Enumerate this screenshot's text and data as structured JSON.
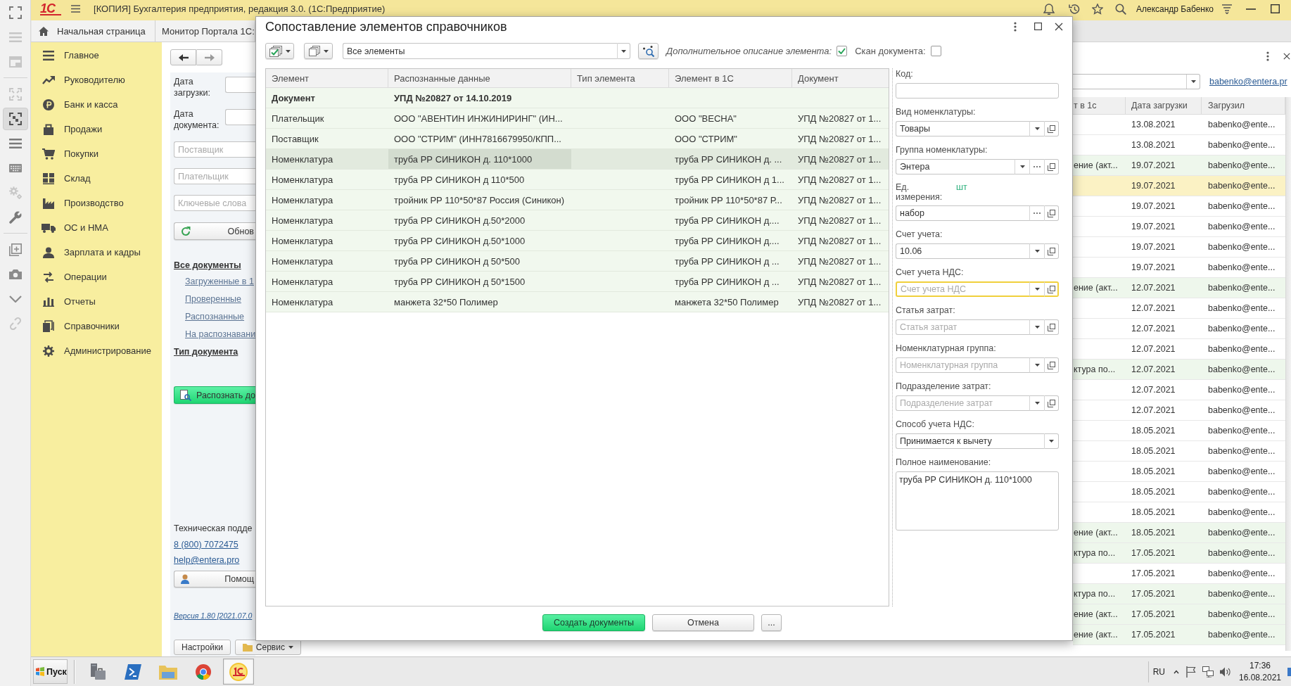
{
  "icon_strip": [
    {
      "selected": false
    },
    {
      "selected": false
    },
    {
      "selected": false
    },
    {
      "selected": false
    },
    {
      "selected": true
    },
    {
      "selected": false
    },
    {
      "selected": false
    },
    {
      "selected": false
    },
    {
      "selected": false
    },
    {
      "selected": false
    },
    {
      "selected": false
    },
    {
      "selected": false
    },
    {
      "selected": false
    }
  ],
  "app_bar": {
    "logo": "1С",
    "title": "[КОПИЯ] Бухгалтерия предприятия, редакция 3.0. (1С:Предприятие)",
    "user": "Александр Бабенко"
  },
  "open_tabs": [
    "Начальная страница",
    "Монитор Портала 1С:"
  ],
  "sections": [
    "Главное",
    "Руководителю",
    "Банк и касса",
    "Продажи",
    "Покупки",
    "Склад",
    "Производство",
    "ОС и НМА",
    "Зарплата и кадры",
    "Операции",
    "Отчеты",
    "Справочники",
    "Администрирование"
  ],
  "monitor_form": {
    "date_fields": [
      "Дата загрузки:",
      "Дата документа:"
    ],
    "filters": [
      {
        "placeholder": "Поставщик"
      },
      {
        "placeholder": "Плательщик"
      },
      {
        "placeholder": "Ключевые слова"
      }
    ],
    "refresh_button": "Обнов",
    "document_tree": [
      {
        "label": "Все документы",
        "children": [
          "Загруженные в 1",
          "Проверенные",
          "Распознанные",
          "На распознавани"
        ]
      },
      {
        "label": "Тип документа"
      }
    ],
    "recognize_button": "Распознать до",
    "support": {
      "label": "Техническая подде",
      "phone": "8 (800) 7072475",
      "email": "help@entera.pro",
      "help_button": "Помощ"
    },
    "version_link": "Версия 1.80 [2021.07.0",
    "footer_buttons": [
      "Настройки",
      "Сервис"
    ]
  },
  "document_list": {
    "user_link": "babenko@entera.pr",
    "columns": [
      "т в 1с",
      "Дата загрузки",
      "Загрузил"
    ],
    "rows": [
      {
        "upload_date": "13.08.2021",
        "uploaded_by": "babenko@ente...",
        "selected": false,
        "highlighted": false
      },
      {
        "upload_date": "13.08.2021",
        "uploaded_by": "babenko@ente...",
        "selected": false,
        "highlighted": false
      },
      {
        "column_1": "ение (акт...",
        "upload_date": "19.07.2021",
        "uploaded_by": "babenko@ente...",
        "selected": false,
        "highlighted": true
      },
      {
        "upload_date": "19.07.2021",
        "uploaded_by": "babenko@ente...",
        "selected": true,
        "highlighted": false
      },
      {
        "upload_date": "19.07.2021",
        "uploaded_by": "babenko@ente...",
        "selected": false,
        "highlighted": false
      },
      {
        "upload_date": "19.07.2021",
        "uploaded_by": "babenko@ente...",
        "selected": false,
        "highlighted": false
      },
      {
        "upload_date": "19.07.2021",
        "uploaded_by": "babenko@ente...",
        "selected": false,
        "highlighted": false
      },
      {
        "upload_date": "19.07.2021",
        "uploaded_by": "babenko@ente...",
        "selected": false,
        "highlighted": false
      },
      {
        "column_1": "ение (акт...",
        "upload_date": "12.07.2021",
        "uploaded_by": "babenko@ente...",
        "selected": false,
        "highlighted": true
      },
      {
        "upload_date": "12.07.2021",
        "uploaded_by": "babenko@ente...",
        "selected": false,
        "highlighted": false
      },
      {
        "upload_date": "12.07.2021",
        "uploaded_by": "babenko@ente...",
        "selected": false,
        "highlighted": false
      },
      {
        "upload_date": "12.07.2021",
        "uploaded_by": "babenko@ente...",
        "selected": false,
        "highlighted": false
      },
      {
        "column_1": "ктура по...",
        "upload_date": "12.07.2021",
        "uploaded_by": "babenko@ente...",
        "selected": false,
        "highlighted": true
      },
      {
        "upload_date": "12.07.2021",
        "uploaded_by": "babenko@ente...",
        "selected": false,
        "highlighted": false
      },
      {
        "upload_date": "12.07.2021",
        "uploaded_by": "babenko@ente...",
        "selected": false,
        "highlighted": false
      },
      {
        "upload_date": "18.05.2021",
        "uploaded_by": "babenko@ente...",
        "selected": false,
        "highlighted": false
      },
      {
        "upload_date": "18.05.2021",
        "uploaded_by": "babenko@ente...",
        "selected": false,
        "highlighted": false
      },
      {
        "upload_date": "18.05.2021",
        "uploaded_by": "babenko@ente...",
        "selected": false,
        "highlighted": false
      },
      {
        "upload_date": "18.05.2021",
        "uploaded_by": "babenko@ente...",
        "selected": false,
        "highlighted": false
      },
      {
        "upload_date": "18.05.2021",
        "uploaded_by": "babenko@ente...",
        "selected": false,
        "highlighted": false
      },
      {
        "column_1": "ение (акт...",
        "upload_date": "18.05.2021",
        "uploaded_by": "babenko@ente...",
        "selected": false,
        "highlighted": true
      },
      {
        "column_1": "ктура по...",
        "upload_date": "17.05.2021",
        "uploaded_by": "babenko@ente...",
        "selected": false,
        "highlighted": true
      },
      {
        "upload_date": "17.05.2021",
        "uploaded_by": "babenko@ente...",
        "selected": false,
        "highlighted": false
      },
      {
        "column_1": "ктура по...",
        "upload_date": "17.05.2021",
        "uploaded_by": "babenko@ente...",
        "selected": false,
        "highlighted": true
      },
      {
        "column_1": "ение (акт...",
        "upload_date": "17.05.2021",
        "uploaded_by": "babenko@ente...",
        "selected": false,
        "highlighted": true
      },
      {
        "column_1": "ение (акт...",
        "upload_date": "17.05.2021",
        "uploaded_by": "babenko@ente...",
        "selected": false,
        "highlighted": true
      }
    ]
  },
  "dialog": {
    "title": "Сопоставление элементов справочников",
    "filter": "Все элементы",
    "options": [
      {
        "label": "Дополнительное описание элемента:",
        "checked": true
      },
      {
        "label": "Скан документа:",
        "checked": false
      }
    ],
    "table": {
      "columns": [
        "Элемент",
        "Распознанные данные",
        "Тип элемента",
        "Элемент в 1С",
        "Документ"
      ],
      "rows": [
        {
          "kind": "document",
          "selected": false,
          "element": "Документ",
          "recognized": "УПД №20827 от 14.10.2019"
        },
        {
          "kind": "item",
          "selected": false,
          "element": "Плательщик",
          "recognized": "ООО \"АВЕНТИН ИНЖИНИРИНГ\" (ИН...",
          "element_1c": "ООО \"ВЕСНА\"",
          "document": "УПД №20827 от 1..."
        },
        {
          "kind": "item",
          "selected": false,
          "element": "Поставщик",
          "recognized": "ООО \"СТРИМ\" (ИНН7816679950/КПП...",
          "element_1c": "ООО \"СТРИМ\"",
          "document": "УПД №20827 от 1..."
        },
        {
          "kind": "item",
          "selected": true,
          "element": "Номенклатура",
          "recognized": "труба РР СИНИКОН д. 110*1000",
          "element_1c": "труба РР СИНИКОН д. ...",
          "document": "УПД №20827 от 1..."
        },
        {
          "kind": "item",
          "selected": false,
          "element": "Номенклатура",
          "recognized": "труба РР СИНИКОН д 110*500",
          "element_1c": "труба РР СИНИКОН д 1...",
          "document": "УПД №20827 от 1..."
        },
        {
          "kind": "item",
          "selected": false,
          "element": "Номенклатура",
          "recognized": "тройник РР 110*50*87 Россия (Синикон)",
          "element_1c": "тройник РР 110*50*87 Р...",
          "document": "УПД №20827 от 1..."
        },
        {
          "kind": "item",
          "selected": false,
          "element": "Номенклатура",
          "recognized": "труба РР СИНИКОН д.50*2000",
          "element_1c": "труба РР СИНИКОН д....",
          "document": "УПД №20827 от 1..."
        },
        {
          "kind": "item",
          "selected": false,
          "element": "Номенклатура",
          "recognized": "труба РР СИНИКОН д.50*1000",
          "element_1c": "труба РР СИНИКОН д....",
          "document": "УПД №20827 от 1..."
        },
        {
          "kind": "item",
          "selected": false,
          "element": "Номенклатура",
          "recognized": "труба РР СИНИКОН д 50*500",
          "element_1c": "труба РР СИНИКОН д ...",
          "document": "УПД №20827 от 1..."
        },
        {
          "kind": "item",
          "selected": false,
          "element": "Номенклатура",
          "recognized": "труба РР СИНИКОН д 50*1500",
          "element_1c": "труба РР СИНИКОН д ...",
          "document": "УПД №20827 от 1..."
        },
        {
          "kind": "item",
          "selected": false,
          "element": "Номенклатура",
          "recognized": "манжета 32*50 Полимер",
          "element_1c": "манжета 32*50 Полимер",
          "document": "УПД №20827 от 1..."
        }
      ]
    },
    "details": [
      {
        "kind": "text",
        "label": "Код:",
        "focused": false
      },
      {
        "kind": "ref",
        "label": "Вид номенклатуры:",
        "value": "Товары",
        "focused": false
      },
      {
        "kind": "ref_pick",
        "label": "Группа номенклатуры:",
        "value": "Энтера",
        "focused": false
      },
      {
        "kind": "pick",
        "label": "Ед. измерения:",
        "note": "шт",
        "value": "набор",
        "focused": false
      },
      {
        "kind": "ref",
        "label": "Счет учета:",
        "value": "10.06",
        "focused": false
      },
      {
        "kind": "ref",
        "label": "Счет учета НДС:",
        "placeholder": "Счет учета НДС",
        "focused": true
      },
      {
        "kind": "ref",
        "label": "Статья затрат:",
        "placeholder": "Статья затрат",
        "focused": false
      },
      {
        "kind": "ref",
        "label": "Номенклатурная группа:",
        "placeholder": "Номенклатурная группа",
        "focused": false
      },
      {
        "kind": "ref",
        "label": "Подразделение затрат:",
        "placeholder": "Подразделение затрат",
        "focused": false
      },
      {
        "kind": "enum",
        "label": "Способ учета НДС:",
        "value": "Принимается к вычету",
        "focused": false
      },
      {
        "kind": "memo",
        "label": "Полное наименование:",
        "value": "труба РР СИНИКОН д. 110*1000",
        "focused": false
      }
    ],
    "buttons": [
      {
        "label": "Создать документы",
        "kind": "primary"
      },
      {
        "label": "Отмена",
        "kind": "normal"
      },
      {
        "label": "...",
        "kind": "normal"
      }
    ]
  },
  "taskbar": {
    "start": "Пуск",
    "apps": [
      {
        "selected": false
      },
      {
        "selected": false
      },
      {
        "selected": false
      },
      {
        "selected": false
      },
      {
        "selected": true
      }
    ],
    "language": "RU",
    "time": "17:36",
    "date": "16.08.2021"
  }
}
